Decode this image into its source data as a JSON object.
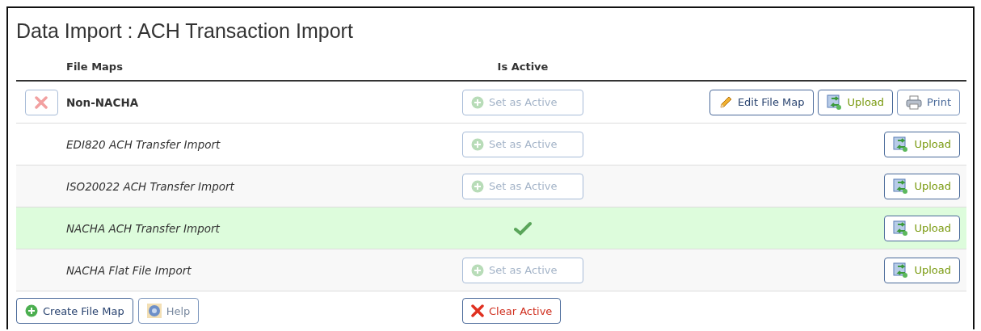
{
  "title": "Data Import : ACH Transaction Import",
  "columns": {
    "file_maps": "File Maps",
    "is_active": "Is Active"
  },
  "rows": [
    {
      "name": "Non-NACHA",
      "kind": "custom",
      "active": false,
      "set_active_label": "Set as Active",
      "actions": [
        {
          "kind": "edit",
          "label": "Edit File Map"
        },
        {
          "kind": "upload",
          "label": "Upload"
        },
        {
          "kind": "print",
          "label": "Print"
        }
      ]
    },
    {
      "name": "EDI820 ACH Transfer Import",
      "kind": "standard",
      "active": false,
      "set_active_label": "Set as Active",
      "actions": [
        {
          "kind": "upload",
          "label": "Upload"
        }
      ]
    },
    {
      "name": "ISO20022 ACH Transfer Import",
      "kind": "standard",
      "active": false,
      "set_active_label": "Set as Active",
      "actions": [
        {
          "kind": "upload",
          "label": "Upload"
        }
      ]
    },
    {
      "name": "NACHA ACH Transfer Import",
      "kind": "standard",
      "active": true,
      "actions": [
        {
          "kind": "upload",
          "label": "Upload"
        }
      ]
    },
    {
      "name": "NACHA Flat File Import",
      "kind": "standard",
      "active": false,
      "set_active_label": "Set as Active",
      "actions": [
        {
          "kind": "upload",
          "label": "Upload"
        }
      ]
    }
  ],
  "footer": [
    {
      "kind": "create",
      "label": "Create File Map"
    },
    {
      "kind": "help",
      "label": "Help"
    },
    {
      "kind": "clear",
      "label": "Clear Active"
    }
  ]
}
